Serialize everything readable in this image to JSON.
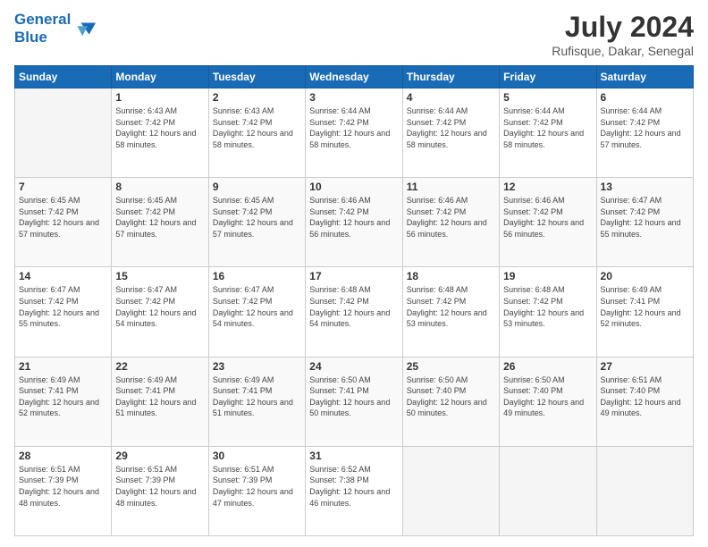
{
  "header": {
    "logo_line1": "General",
    "logo_line2": "Blue",
    "month_year": "July 2024",
    "location": "Rufisque, Dakar, Senegal"
  },
  "days_of_week": [
    "Sunday",
    "Monday",
    "Tuesday",
    "Wednesday",
    "Thursday",
    "Friday",
    "Saturday"
  ],
  "weeks": [
    [
      {
        "day": "",
        "sunrise": "",
        "sunset": "",
        "daylight": "",
        "empty": true
      },
      {
        "day": "1",
        "sunrise": "Sunrise: 6:43 AM",
        "sunset": "Sunset: 7:42 PM",
        "daylight": "Daylight: 12 hours and 58 minutes.",
        "empty": false
      },
      {
        "day": "2",
        "sunrise": "Sunrise: 6:43 AM",
        "sunset": "Sunset: 7:42 PM",
        "daylight": "Daylight: 12 hours and 58 minutes.",
        "empty": false
      },
      {
        "day": "3",
        "sunrise": "Sunrise: 6:44 AM",
        "sunset": "Sunset: 7:42 PM",
        "daylight": "Daylight: 12 hours and 58 minutes.",
        "empty": false
      },
      {
        "day": "4",
        "sunrise": "Sunrise: 6:44 AM",
        "sunset": "Sunset: 7:42 PM",
        "daylight": "Daylight: 12 hours and 58 minutes.",
        "empty": false
      },
      {
        "day": "5",
        "sunrise": "Sunrise: 6:44 AM",
        "sunset": "Sunset: 7:42 PM",
        "daylight": "Daylight: 12 hours and 58 minutes.",
        "empty": false
      },
      {
        "day": "6",
        "sunrise": "Sunrise: 6:44 AM",
        "sunset": "Sunset: 7:42 PM",
        "daylight": "Daylight: 12 hours and 57 minutes.",
        "empty": false
      }
    ],
    [
      {
        "day": "7",
        "sunrise": "Sunrise: 6:45 AM",
        "sunset": "Sunset: 7:42 PM",
        "daylight": "Daylight: 12 hours and 57 minutes.",
        "empty": false
      },
      {
        "day": "8",
        "sunrise": "Sunrise: 6:45 AM",
        "sunset": "Sunset: 7:42 PM",
        "daylight": "Daylight: 12 hours and 57 minutes.",
        "empty": false
      },
      {
        "day": "9",
        "sunrise": "Sunrise: 6:45 AM",
        "sunset": "Sunset: 7:42 PM",
        "daylight": "Daylight: 12 hours and 57 minutes.",
        "empty": false
      },
      {
        "day": "10",
        "sunrise": "Sunrise: 6:46 AM",
        "sunset": "Sunset: 7:42 PM",
        "daylight": "Daylight: 12 hours and 56 minutes.",
        "empty": false
      },
      {
        "day": "11",
        "sunrise": "Sunrise: 6:46 AM",
        "sunset": "Sunset: 7:42 PM",
        "daylight": "Daylight: 12 hours and 56 minutes.",
        "empty": false
      },
      {
        "day": "12",
        "sunrise": "Sunrise: 6:46 AM",
        "sunset": "Sunset: 7:42 PM",
        "daylight": "Daylight: 12 hours and 56 minutes.",
        "empty": false
      },
      {
        "day": "13",
        "sunrise": "Sunrise: 6:47 AM",
        "sunset": "Sunset: 7:42 PM",
        "daylight": "Daylight: 12 hours and 55 minutes.",
        "empty": false
      }
    ],
    [
      {
        "day": "14",
        "sunrise": "Sunrise: 6:47 AM",
        "sunset": "Sunset: 7:42 PM",
        "daylight": "Daylight: 12 hours and 55 minutes.",
        "empty": false
      },
      {
        "day": "15",
        "sunrise": "Sunrise: 6:47 AM",
        "sunset": "Sunset: 7:42 PM",
        "daylight": "Daylight: 12 hours and 54 minutes.",
        "empty": false
      },
      {
        "day": "16",
        "sunrise": "Sunrise: 6:47 AM",
        "sunset": "Sunset: 7:42 PM",
        "daylight": "Daylight: 12 hours and 54 minutes.",
        "empty": false
      },
      {
        "day": "17",
        "sunrise": "Sunrise: 6:48 AM",
        "sunset": "Sunset: 7:42 PM",
        "daylight": "Daylight: 12 hours and 54 minutes.",
        "empty": false
      },
      {
        "day": "18",
        "sunrise": "Sunrise: 6:48 AM",
        "sunset": "Sunset: 7:42 PM",
        "daylight": "Daylight: 12 hours and 53 minutes.",
        "empty": false
      },
      {
        "day": "19",
        "sunrise": "Sunrise: 6:48 AM",
        "sunset": "Sunset: 7:42 PM",
        "daylight": "Daylight: 12 hours and 53 minutes.",
        "empty": false
      },
      {
        "day": "20",
        "sunrise": "Sunrise: 6:49 AM",
        "sunset": "Sunset: 7:41 PM",
        "daylight": "Daylight: 12 hours and 52 minutes.",
        "empty": false
      }
    ],
    [
      {
        "day": "21",
        "sunrise": "Sunrise: 6:49 AM",
        "sunset": "Sunset: 7:41 PM",
        "daylight": "Daylight: 12 hours and 52 minutes.",
        "empty": false
      },
      {
        "day": "22",
        "sunrise": "Sunrise: 6:49 AM",
        "sunset": "Sunset: 7:41 PM",
        "daylight": "Daylight: 12 hours and 51 minutes.",
        "empty": false
      },
      {
        "day": "23",
        "sunrise": "Sunrise: 6:49 AM",
        "sunset": "Sunset: 7:41 PM",
        "daylight": "Daylight: 12 hours and 51 minutes.",
        "empty": false
      },
      {
        "day": "24",
        "sunrise": "Sunrise: 6:50 AM",
        "sunset": "Sunset: 7:41 PM",
        "daylight": "Daylight: 12 hours and 50 minutes.",
        "empty": false
      },
      {
        "day": "25",
        "sunrise": "Sunrise: 6:50 AM",
        "sunset": "Sunset: 7:40 PM",
        "daylight": "Daylight: 12 hours and 50 minutes.",
        "empty": false
      },
      {
        "day": "26",
        "sunrise": "Sunrise: 6:50 AM",
        "sunset": "Sunset: 7:40 PM",
        "daylight": "Daylight: 12 hours and 49 minutes.",
        "empty": false
      },
      {
        "day": "27",
        "sunrise": "Sunrise: 6:51 AM",
        "sunset": "Sunset: 7:40 PM",
        "daylight": "Daylight: 12 hours and 49 minutes.",
        "empty": false
      }
    ],
    [
      {
        "day": "28",
        "sunrise": "Sunrise: 6:51 AM",
        "sunset": "Sunset: 7:39 PM",
        "daylight": "Daylight: 12 hours and 48 minutes.",
        "empty": false
      },
      {
        "day": "29",
        "sunrise": "Sunrise: 6:51 AM",
        "sunset": "Sunset: 7:39 PM",
        "daylight": "Daylight: 12 hours and 48 minutes.",
        "empty": false
      },
      {
        "day": "30",
        "sunrise": "Sunrise: 6:51 AM",
        "sunset": "Sunset: 7:39 PM",
        "daylight": "Daylight: 12 hours and 47 minutes.",
        "empty": false
      },
      {
        "day": "31",
        "sunrise": "Sunrise: 6:52 AM",
        "sunset": "Sunset: 7:38 PM",
        "daylight": "Daylight: 12 hours and 46 minutes.",
        "empty": false
      },
      {
        "day": "",
        "sunrise": "",
        "sunset": "",
        "daylight": "",
        "empty": true
      },
      {
        "day": "",
        "sunrise": "",
        "sunset": "",
        "daylight": "",
        "empty": true
      },
      {
        "day": "",
        "sunrise": "",
        "sunset": "",
        "daylight": "",
        "empty": true
      }
    ]
  ]
}
